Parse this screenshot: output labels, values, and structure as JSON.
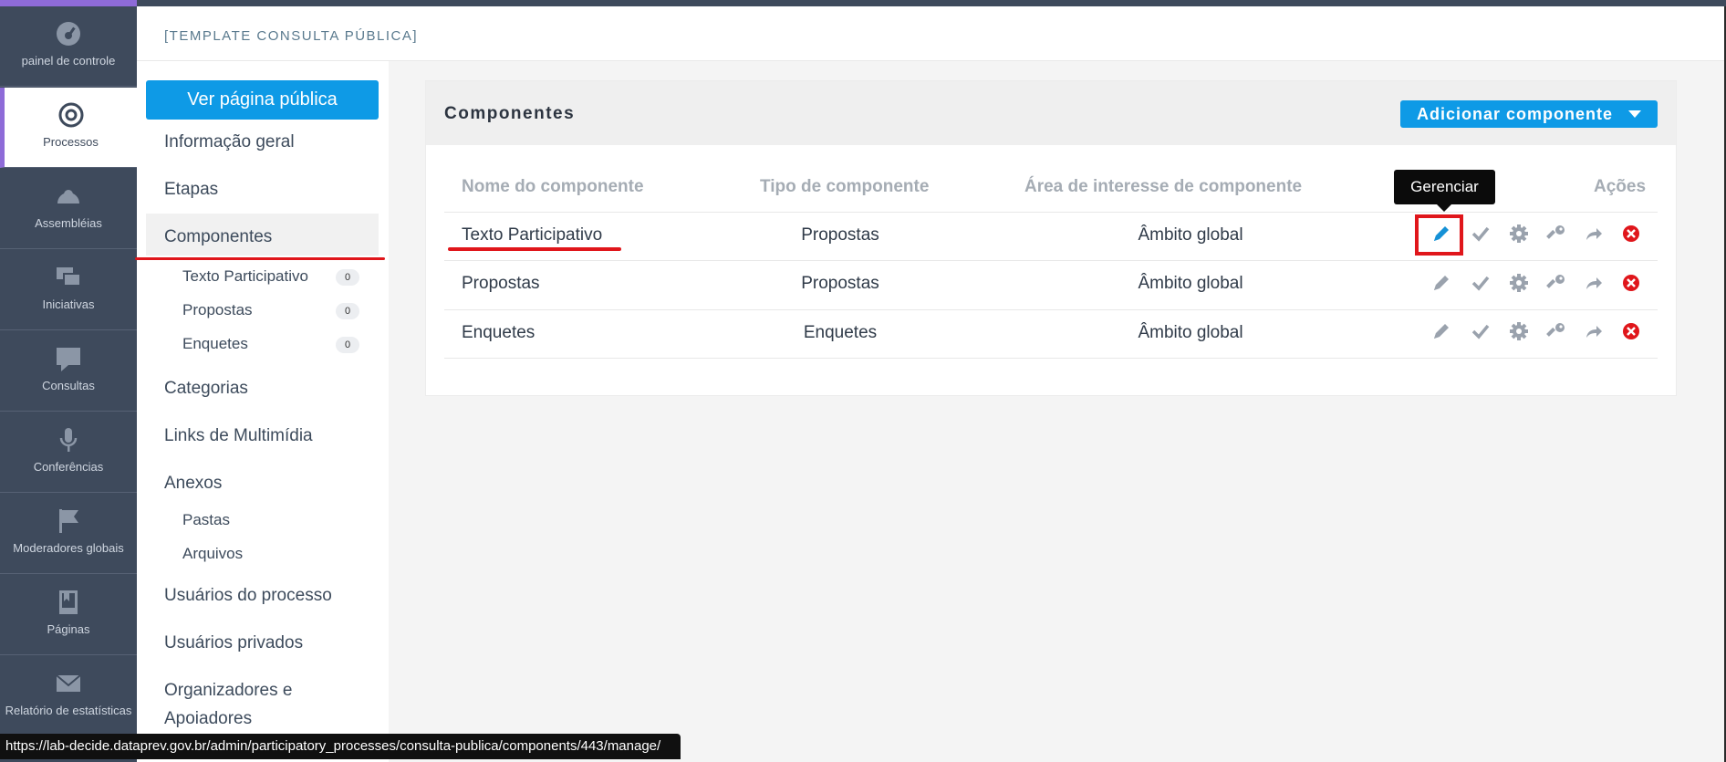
{
  "header": {
    "title": "[TEMPLATE CONSULTA PÚBLICA]"
  },
  "leftnav": [
    {
      "label": "painel de controle",
      "icon": "dashboard-icon"
    },
    {
      "label": "Processos",
      "icon": "target-icon",
      "active": true
    },
    {
      "label": "Assembléias",
      "icon": "assembly-icon"
    },
    {
      "label": "Iniciativas",
      "icon": "chat-bubbles-icon"
    },
    {
      "label": "Consultas",
      "icon": "comment-icon"
    },
    {
      "label": "Conferências",
      "icon": "microphone-icon"
    },
    {
      "label": "Moderadores globais",
      "icon": "flag-icon"
    },
    {
      "label": "Páginas",
      "icon": "book-icon"
    },
    {
      "label": "Relatório de estatísticas",
      "icon": "mail-icon"
    }
  ],
  "sidebar": {
    "public_button": "Ver página pública",
    "links": {
      "info": "Informação geral",
      "steps": "Etapas",
      "components": "Componentes",
      "categories": "Categorias",
      "multimedia": "Links de Multimídia",
      "attachments": "Anexos",
      "process_users": "Usuários do processo",
      "private_users": "Usuários privados",
      "organizers": "Organizadores e",
      "organizers2": "Apoiadores"
    },
    "component_subitems": [
      {
        "label": "Texto Participativo",
        "count": "0"
      },
      {
        "label": "Propostas",
        "count": "0"
      },
      {
        "label": "Enquetes",
        "count": "0"
      }
    ],
    "attachment_subitems": {
      "folders": "Pastas",
      "files": "Arquivos"
    }
  },
  "main": {
    "card_title": "Componentes",
    "add_button": "Adicionar componente",
    "columns": {
      "name": "Nome do componente",
      "type": "Tipo de componente",
      "scope": "Área de interesse de componente",
      "actions": "Ações"
    },
    "rows": [
      {
        "name": "Texto Participativo",
        "type": "Propostas",
        "scope": "Âmbito global"
      },
      {
        "name": "Propostas",
        "type": "Propostas",
        "scope": "Âmbito global"
      },
      {
        "name": "Enquetes",
        "type": "Enquetes",
        "scope": "Âmbito global"
      }
    ],
    "tooltip": "Gerenciar"
  },
  "status_url": "https://lab-decide.dataprev.gov.br/admin/participatory_processes/consulta-publica/components/443/manage/",
  "colors": {
    "accent": "#0e9ae6",
    "nav_bg": "#3e4a5c",
    "danger": "#e0161b",
    "active_icon": "#1591d6",
    "muted_icon": "#9aa2ad"
  }
}
